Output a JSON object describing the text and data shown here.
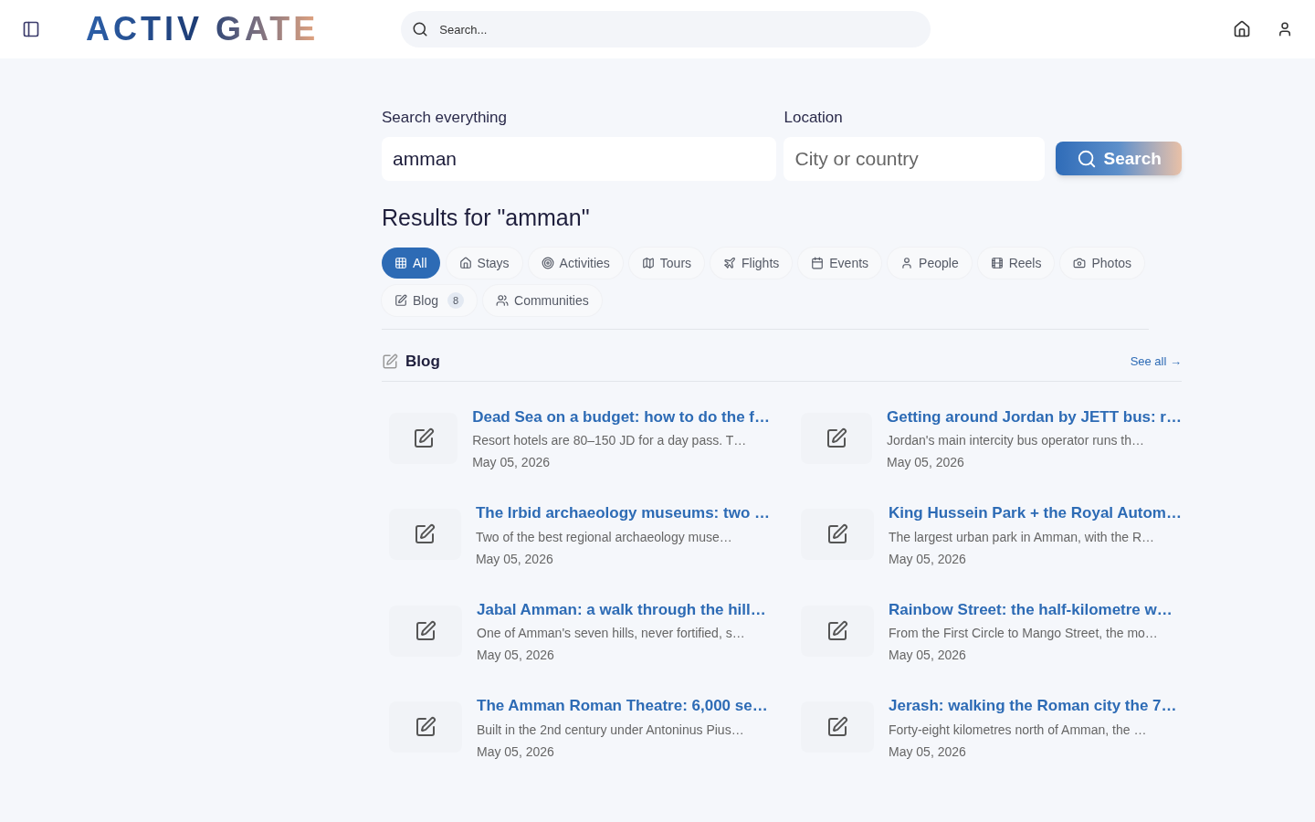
{
  "header": {
    "logo": "ACTIV GATE",
    "search": {
      "placeholder": "Search..."
    }
  },
  "search_form": {
    "query_label": "Search everything",
    "query_value": "amman",
    "location_label": "Location",
    "location_placeholder": "City or country",
    "button": "Search"
  },
  "results_title": "Results for \"amman\"",
  "filters": [
    {
      "label": "All",
      "kind": "all",
      "selected": true
    },
    {
      "label": "Stays",
      "kind": "stays",
      "selected": false
    },
    {
      "label": "Activities",
      "kind": "activities",
      "selected": false
    },
    {
      "label": "Tours",
      "kind": "tours",
      "selected": false
    },
    {
      "label": "Flights",
      "kind": "flights",
      "selected": false
    },
    {
      "label": "Events",
      "kind": "events",
      "selected": false
    },
    {
      "label": "People",
      "kind": "people",
      "selected": false
    },
    {
      "label": "Reels",
      "kind": "reels",
      "selected": false
    },
    {
      "label": "Photos",
      "kind": "photos",
      "selected": false
    },
    {
      "label": "Blog",
      "kind": "blog",
      "selected": false,
      "count": "8"
    },
    {
      "label": "Communities",
      "kind": "communities",
      "selected": false
    }
  ],
  "blog_section": {
    "title": "Blog",
    "see_all": "See all →",
    "posts": [
      {
        "title": "Dead Sea on a budget: how to do the f…",
        "excerpt": "Resort hotels are 80–150 JD for a day pass. T…",
        "date": "May 05, 2026"
      },
      {
        "title": "Getting around Jordan by JETT bus: r…",
        "excerpt": "Jordan's main intercity bus operator runs th…",
        "date": "May 05, 2026"
      },
      {
        "title": "The Irbid archaeology museums: two …",
        "excerpt": "Two of the best regional archaeology muse…",
        "date": "May 05, 2026"
      },
      {
        "title": "King Hussein Park + the Royal Autom…",
        "excerpt": "The largest urban park in Amman, with the R…",
        "date": "May 05, 2026"
      },
      {
        "title": "Jabal Amman: a walk through the hill…",
        "excerpt": "One of Amman's seven hills, never fortified, s…",
        "date": "May 05, 2026"
      },
      {
        "title": "Rainbow Street: the half-kilometre w…",
        "excerpt": "From the First Circle to Mango Street, the mo…",
        "date": "May 05, 2026"
      },
      {
        "title": "The Amman Roman Theatre: 6,000 se…",
        "excerpt": "Built in the 2nd century under Antoninus Pius…",
        "date": "May 05, 2026"
      },
      {
        "title": "Jerash: walking the Roman city the 7…",
        "excerpt": "Forty-eight kilometres north of Amman, the …",
        "date": "May 05, 2026"
      }
    ]
  }
}
